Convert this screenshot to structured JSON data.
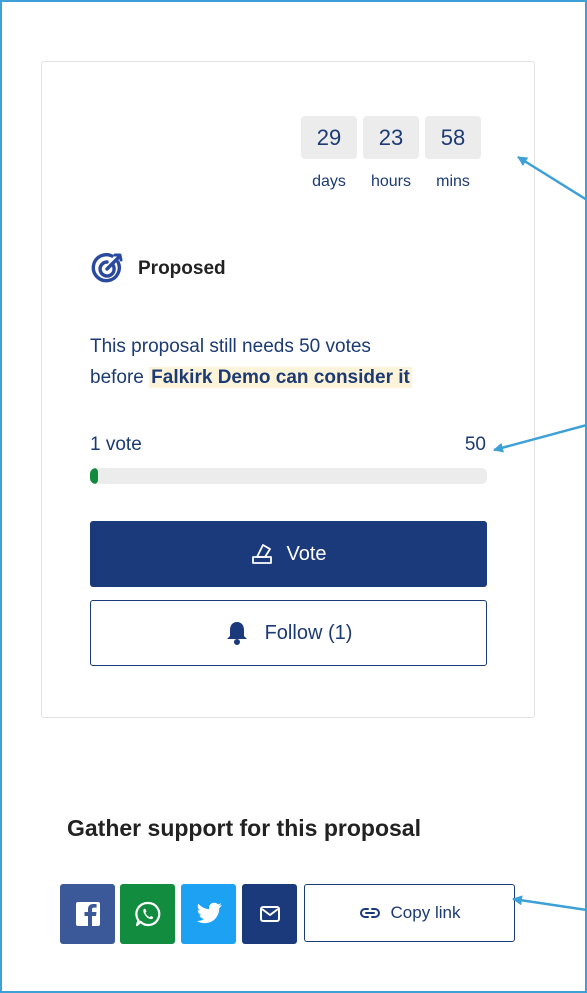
{
  "countdown": {
    "days": "29",
    "hours": "23",
    "mins": "58",
    "days_label": "days",
    "hours_label": "hours",
    "mins_label": "mins"
  },
  "status": {
    "icon": "target-icon",
    "label": "Proposed"
  },
  "needs": {
    "line1": "This proposal still needs 50 votes",
    "line2_prefix": "before ",
    "line2_highlight": "Falkirk Demo can consider it"
  },
  "votes": {
    "current_label": "1 vote",
    "goal_label": "50",
    "progress_fraction": 0.02
  },
  "buttons": {
    "vote_label": "Vote",
    "vote_icon": "ballot-box-icon",
    "follow_label": "Follow (1)",
    "follow_icon": "bell-icon"
  },
  "share": {
    "title": "Gather support for this proposal",
    "items": [
      {
        "name": "facebook-icon",
        "color": "#3b5998"
      },
      {
        "name": "whatsapp-icon",
        "color": "#128c3e"
      },
      {
        "name": "twitter-icon",
        "color": "#1da1f2"
      },
      {
        "name": "email-icon",
        "color": "#1b3a7c"
      }
    ],
    "copy_label": "Copy link",
    "copy_icon": "link-icon"
  },
  "colors": {
    "primary": "#1b3a7c",
    "text": "#1c3a73",
    "progress": "#128a3e",
    "highlight": "#fdf3d8",
    "annotation": "#3da0d6"
  }
}
